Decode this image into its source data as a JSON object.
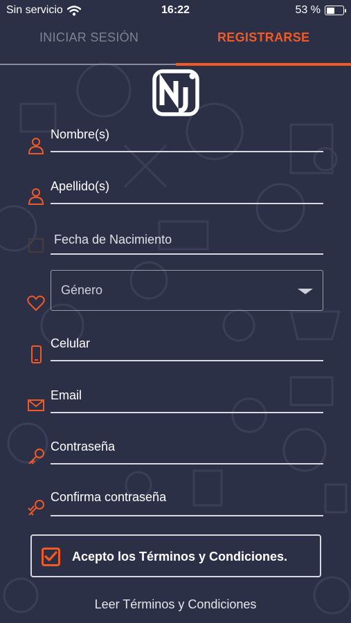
{
  "status_bar": {
    "carrier": "Sin servicio",
    "time": "16:22",
    "battery_text": "53 %",
    "battery_level": 0.53
  },
  "tabs": {
    "login": "INICIAR SESIÓN",
    "register": "REGISTRARSE",
    "active": "register"
  },
  "logo": {
    "text": "Nj",
    "icon": "nj-logo"
  },
  "form": {
    "fields": [
      {
        "label": "Nombre(s)",
        "icon": "person-icon"
      },
      {
        "label": "Apellido(s)",
        "icon": "person-icon"
      },
      {
        "label": "Fecha de Nacimiento",
        "icon": "calendar-icon"
      },
      {
        "label": "Celular",
        "icon": "phone-icon"
      },
      {
        "label": "Email",
        "icon": "envelope-icon"
      },
      {
        "label": "Contraseña",
        "icon": "key-icon"
      },
      {
        "label": "Confirma contraseña",
        "icon": "key-check-icon"
      }
    ],
    "gender": {
      "label": "Género",
      "icon": "heart-icon"
    }
  },
  "terms": {
    "accept_label": "Acepto los Términos y Condiciones.",
    "checked": true,
    "read_link": "Leer Términos y Condiciones"
  },
  "colors": {
    "background": "#2c3047",
    "accent": "#f15a24",
    "text": "#ffffff",
    "inactive_tab": "#7e8292"
  }
}
